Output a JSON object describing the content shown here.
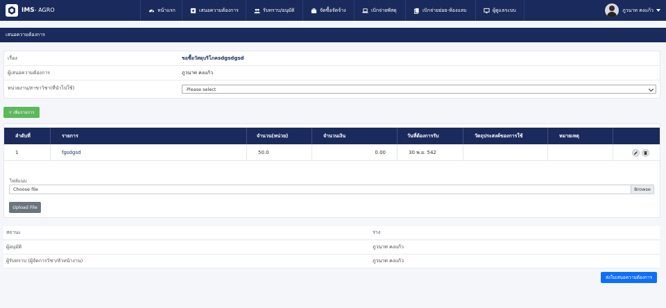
{
  "brand": {
    "name": "IMS",
    "sub": "- AGRO"
  },
  "nav": {
    "items": [
      {
        "label": "หน้าแรก",
        "icon": "dashboard-icon"
      },
      {
        "label": "เสนอความต้องการ",
        "icon": "plus-square-icon"
      },
      {
        "label": "รับทราบ/อนุมัติ",
        "icon": "users-icon"
      },
      {
        "label": "จัดซื้อจัดจ้าง",
        "icon": "briefcase-icon"
      },
      {
        "label": "เบิกจ่ายพัสดุ",
        "icon": "laptop-icon"
      },
      {
        "label": "เบิกจ่ายย่อย-ห้องแลบ",
        "icon": "copy-icon"
      },
      {
        "label": "ผู้ดูแลระบบ",
        "icon": "desktop-icon"
      }
    ]
  },
  "user": {
    "name": "ภูวนาท คงแก้ว"
  },
  "page": {
    "title": "เสนอความต้องการ"
  },
  "form": {
    "subject_label": "เรื่อง",
    "subject_value": "ขอซื้อวัสดุบริโภคsdgsdgsd",
    "requester_label": "ผู้เสนอความต้องการ",
    "requester_value": "ภูวนาท คงแก้ว",
    "unit_label": "หน่วยงาน/สาขาวิชา(ที่นำไปใช้)",
    "unit_selected": "Please select"
  },
  "add_button": "+ เพิ่มรายการ",
  "table": {
    "headers": [
      "ลำดับที่",
      "รายการ",
      "จำนวน(หน่วย)",
      "จำนวนเงิน",
      "วันที่ต้องการรับ",
      "วัตถุประสงค์ของการใช้",
      "หมายเหตุ",
      ""
    ],
    "rows": [
      {
        "no": "1",
        "item": "fgsdgsd",
        "qty": "50.0",
        "amount": "0.00",
        "date": "30 พ.ย. 542",
        "purpose": "",
        "note": ""
      }
    ]
  },
  "attachment": {
    "label": "ไฟล์แนบ",
    "placeholder": "Choose file",
    "browse_label": "Browse",
    "upload_label": "Upload File"
  },
  "info": {
    "status_label": "สถานะ",
    "status_value": "ร่าง",
    "approver_label": "ผู้อนุมัติ",
    "approver_value": "ภูวนาท คงแก้ว",
    "acknowledger_label": "ผู้รับทราบ (ผู้จัดการวิชา/หัวหน้างาน)",
    "acknowledger_value": "ภูวนาท คงแก้ว"
  },
  "submit_label": "ส่งใบเสนอความต้องการ",
  "colors": {
    "navy": "#1a2a5c",
    "green": "#5cb85c",
    "blue": "#0d6efd",
    "gray": "#6c757d"
  }
}
